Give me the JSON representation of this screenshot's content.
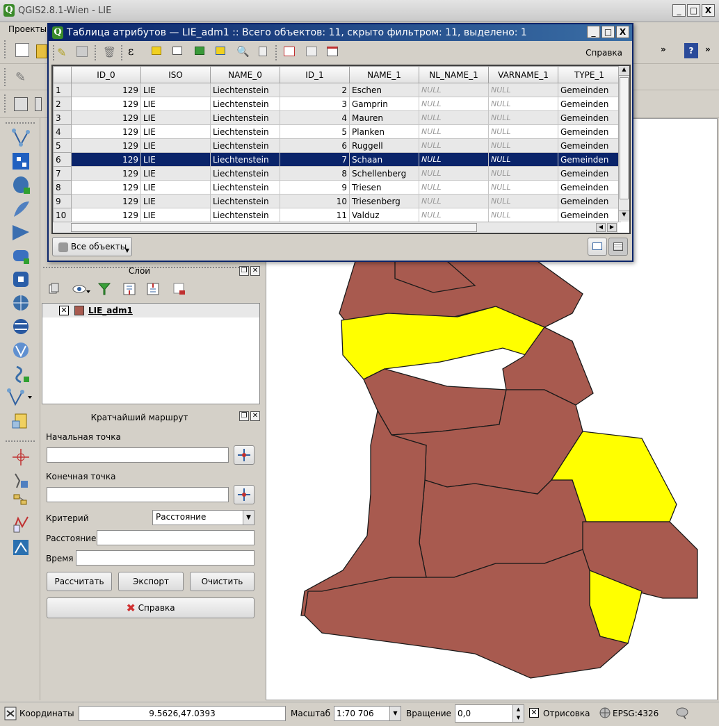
{
  "window": {
    "title": "QGIS2.8.1-Wien - LIE",
    "min": "_",
    "max": "□",
    "close": "X"
  },
  "menu": {
    "projects": "Проекты"
  },
  "toolbar": {
    "more": "»"
  },
  "layers_panel": {
    "title": "Слои",
    "layer_name": "LIE_adm1",
    "layer_color": "#a85a4f"
  },
  "route_panel": {
    "title": "Кратчайший маршрут",
    "start_label": "Начальная точка",
    "start_value": "",
    "end_label": "Конечная точка",
    "end_value": "",
    "criterion_label": "Критерий",
    "criterion_value": "Расстояние",
    "distance_label": "Расстояние",
    "distance_value": "",
    "time_label": "Время",
    "time_value": "",
    "calc": "Рассчитать",
    "export": "Экспорт",
    "clear": "Очистить",
    "help": "Справка"
  },
  "attr_dialog": {
    "title": "Таблица атрибутов — LIE_adm1 :: Всего объектов: 11, скрыто фильтром: 11, выделено: 1",
    "help": "Справка",
    "filter_label": "Все объекты",
    "columns": [
      "ID_0",
      "ISO",
      "NAME_0",
      "ID_1",
      "NAME_1",
      "NL_NAME_1",
      "VARNAME_1",
      "TYPE_1"
    ],
    "rows": [
      {
        "n": "1",
        "id0": "129",
        "iso": "LIE",
        "name0": "Liechtenstein",
        "id1": "2",
        "name1": "Eschen",
        "nl": "NULL",
        "var": "NULL",
        "type": "Gemeinden"
      },
      {
        "n": "2",
        "id0": "129",
        "iso": "LIE",
        "name0": "Liechtenstein",
        "id1": "3",
        "name1": "Gamprin",
        "nl": "NULL",
        "var": "NULL",
        "type": "Gemeinden"
      },
      {
        "n": "3",
        "id0": "129",
        "iso": "LIE",
        "name0": "Liechtenstein",
        "id1": "4",
        "name1": "Mauren",
        "nl": "NULL",
        "var": "NULL",
        "type": "Gemeinden"
      },
      {
        "n": "4",
        "id0": "129",
        "iso": "LIE",
        "name0": "Liechtenstein",
        "id1": "5",
        "name1": "Planken",
        "nl": "NULL",
        "var": "NULL",
        "type": "Gemeinden"
      },
      {
        "n": "5",
        "id0": "129",
        "iso": "LIE",
        "name0": "Liechtenstein",
        "id1": "6",
        "name1": "Ruggell",
        "nl": "NULL",
        "var": "NULL",
        "type": "Gemeinden"
      },
      {
        "n": "6",
        "id0": "129",
        "iso": "LIE",
        "name0": "Liechtenstein",
        "id1": "7",
        "name1": "Schaan",
        "nl": "NULL",
        "var": "NULL",
        "type": "Gemeinden",
        "selected": true
      },
      {
        "n": "7",
        "id0": "129",
        "iso": "LIE",
        "name0": "Liechtenstein",
        "id1": "8",
        "name1": "Schellenberg",
        "nl": "NULL",
        "var": "NULL",
        "type": "Gemeinden"
      },
      {
        "n": "8",
        "id0": "129",
        "iso": "LIE",
        "name0": "Liechtenstein",
        "id1": "9",
        "name1": "Triesen",
        "nl": "NULL",
        "var": "NULL",
        "type": "Gemeinden"
      },
      {
        "n": "9",
        "id0": "129",
        "iso": "LIE",
        "name0": "Liechtenstein",
        "id1": "10",
        "name1": "Triesenberg",
        "nl": "NULL",
        "var": "NULL",
        "type": "Gemeinden"
      },
      {
        "n": "10",
        "id0": "129",
        "iso": "LIE",
        "name0": "Liechtenstein",
        "id1": "11",
        "name1": "Valduz",
        "nl": "NULL",
        "var": "NULL",
        "type": "Gemeinden"
      }
    ]
  },
  "map": {
    "fill_color": "#a85a4f",
    "highlight_color": "#ffff00"
  },
  "statusbar": {
    "coords_label": "Координаты",
    "coords_value": "9.5626,47.0393",
    "scale_label": "Масштаб",
    "scale_value": "1:70 706",
    "rotation_label": "Вращение",
    "rotation_value": "0,0",
    "render_label": "Отрисовка",
    "crs": "EPSG:4326"
  }
}
